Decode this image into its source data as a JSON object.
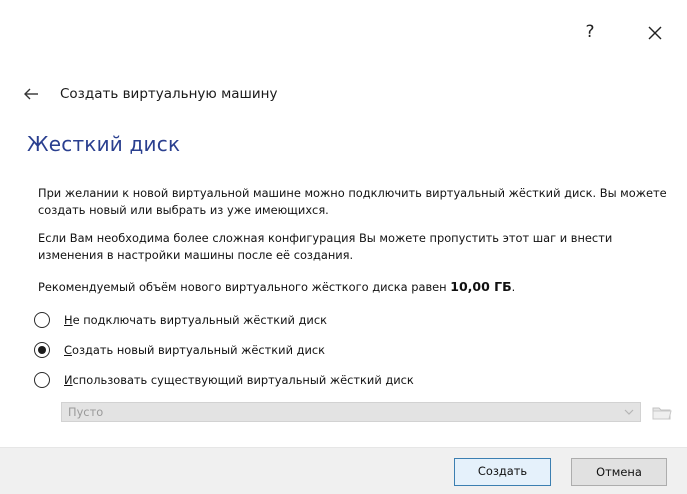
{
  "window": {
    "help_label": "?",
    "close_icon": "close-icon"
  },
  "wizard": {
    "back_icon": "back-arrow-icon",
    "title": "Создать виртуальную машину"
  },
  "page": {
    "section_title": "Жесткий диск",
    "paragraph_1": "При желании к новой виртуальной машине можно подключить виртуальный жёсткий диск. Вы можете создать новый или выбрать из уже имеющихся.",
    "paragraph_2": "Если Вам необходима более сложная конфигурация Вы можете пропустить этот шаг и внести изменения в настройки машины после её создания.",
    "recommended_prefix": "Рекомендуемый объём нового виртуального жёсткого диска равен ",
    "recommended_size": "10,00 ГБ",
    "recommended_suffix": "."
  },
  "options": [
    {
      "mnemonic": "Н",
      "rest": "е подключать виртуальный жёсткий диск",
      "selected": false
    },
    {
      "mnemonic": "С",
      "rest": "оздать новый виртуальный жёсткий диск",
      "selected": true
    },
    {
      "mnemonic": "И",
      "rest": "спользовать существующий виртуальный жёсткий диск",
      "selected": false
    }
  ],
  "disk_selector": {
    "value": "Пусто",
    "enabled": false
  },
  "buttons": {
    "create": "Создать",
    "cancel": "Отмена"
  },
  "colors": {
    "section_title": "#2a3f8f",
    "default_button_border": "#3c7fb1",
    "footer_background": "#f0f0f0"
  }
}
